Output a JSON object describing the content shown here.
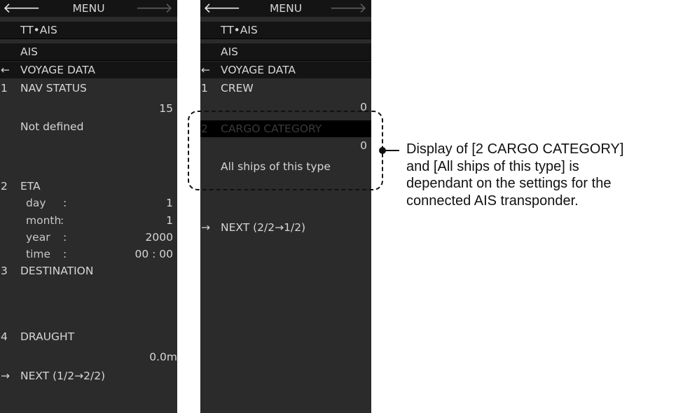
{
  "left_menu": {
    "title": "MENU",
    "back_arrow": "🡐",
    "forward_arrow": "🡒",
    "crumb1": "TT•AIS",
    "crumb2": "AIS",
    "crumb3_arrow": "←",
    "crumb3": "VOYAGE DATA",
    "nav_status": {
      "num": "1",
      "label": "NAV STATUS",
      "value": "15",
      "text": "Not defined"
    },
    "eta": {
      "num": "2",
      "label": "ETA",
      "day_label": "day",
      "day_value": "1",
      "month_label": "month",
      "month_value": "1",
      "year_label": "year",
      "year_value": "2000",
      "time_label": "time",
      "time_value": "00 : 00",
      "colon": ":"
    },
    "destination": {
      "num": "3",
      "label": "DESTINATION"
    },
    "draught": {
      "num": "4",
      "label": "DRAUGHT",
      "value": "0.0m"
    },
    "next": {
      "arrow": "→",
      "label": "NEXT (1/2→2/2)"
    }
  },
  "right_menu": {
    "title": "MENU",
    "back_arrow": "🡐",
    "forward_arrow": "🡒",
    "crumb1": "TT•AIS",
    "crumb2": "AIS",
    "crumb3_arrow": "←",
    "crumb3": "VOYAGE DATA",
    "crew": {
      "num": "1",
      "label": "CREW",
      "value": "0"
    },
    "cargo": {
      "num": "2",
      "label": "CARGO CATEGORY",
      "value": "0",
      "text": "All ships of this type"
    },
    "next": {
      "arrow": "→",
      "label": "NEXT (2/2→1/2)"
    }
  },
  "annotation": {
    "line1": "Display of [2 CARGO CATEGORY]",
    "line2": "and [All ships of this type] is",
    "line3": "dependant on the settings for the",
    "line4": "connected AIS transponder."
  }
}
